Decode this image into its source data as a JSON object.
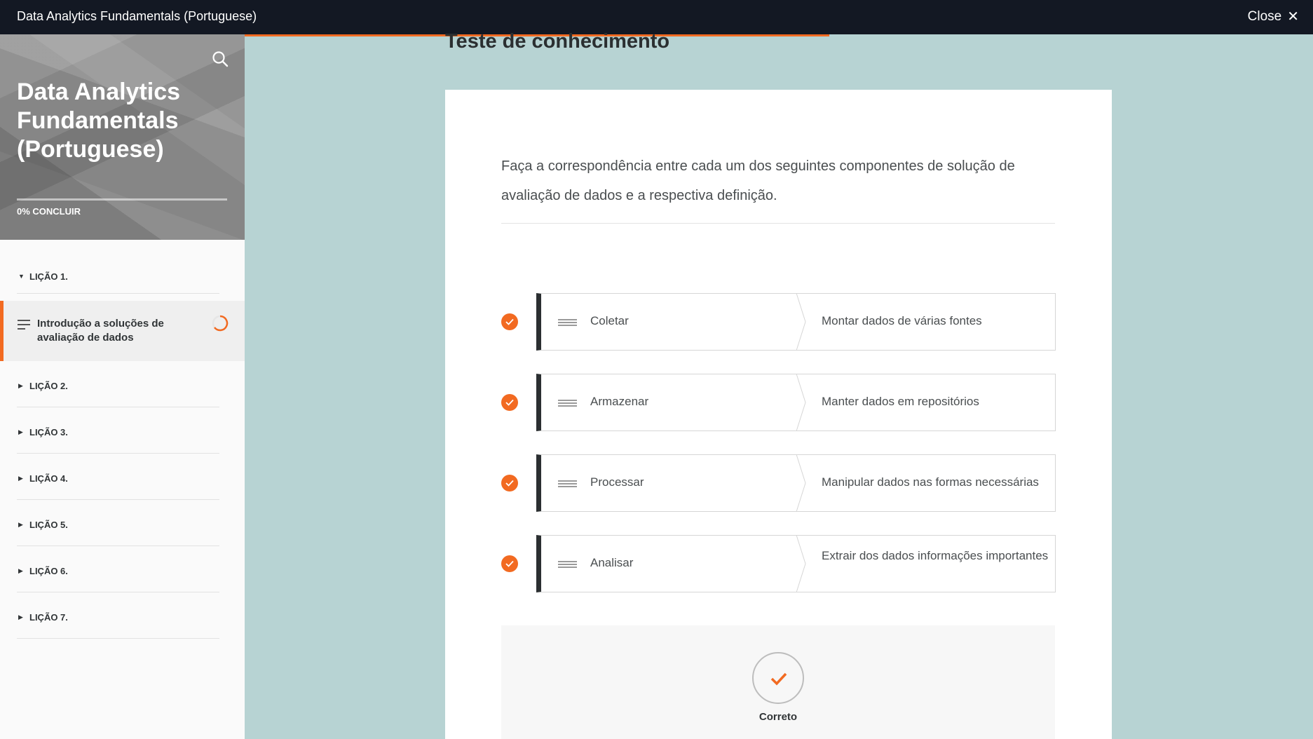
{
  "topbar": {
    "title": "Data Analytics Fundamentals (Portuguese)",
    "close_label": "Close",
    "close_glyph": "✕"
  },
  "sidebar": {
    "course_title": "Data Analytics Fundamentals (Portuguese)",
    "progress_label": "0% CONCLUIR",
    "progress_fraction": 0,
    "search_icon": "search-icon",
    "lessons": [
      {
        "label": "LIÇÃO 1.",
        "expanded": true
      },
      {
        "label": "LIÇÃO 2.",
        "expanded": false
      },
      {
        "label": "LIÇÃO 3.",
        "expanded": false
      },
      {
        "label": "LIÇÃO 4.",
        "expanded": false
      },
      {
        "label": "LIÇÃO 5.",
        "expanded": false
      },
      {
        "label": "LIÇÃO 6.",
        "expanded": false
      },
      {
        "label": "LIÇÃO 7.",
        "expanded": false
      }
    ],
    "active_item": {
      "label": "Introdução a soluções de avaliação de dados",
      "status": "in-progress"
    }
  },
  "main": {
    "heading": "Teste de conhecimento",
    "question": "Faça a correspondência entre cada um dos seguintes componentes de solução de avaliação de dados e a respectiva definição.",
    "pairs": [
      {
        "term": "Coletar",
        "definition": "Montar dados de várias fontes",
        "correct": true
      },
      {
        "term": "Armazenar",
        "definition": "Manter dados em repositórios",
        "correct": true
      },
      {
        "term": "Processar",
        "definition": "Manipular dados nas formas necessárias",
        "correct": true
      },
      {
        "term": "Analisar",
        "definition": "Extrair dos dados informações importantes",
        "correct": true
      }
    ],
    "feedback_label": "Correto"
  },
  "colors": {
    "accent": "#f26a21",
    "topbar": "#131823",
    "background": "#b7d3d3"
  }
}
